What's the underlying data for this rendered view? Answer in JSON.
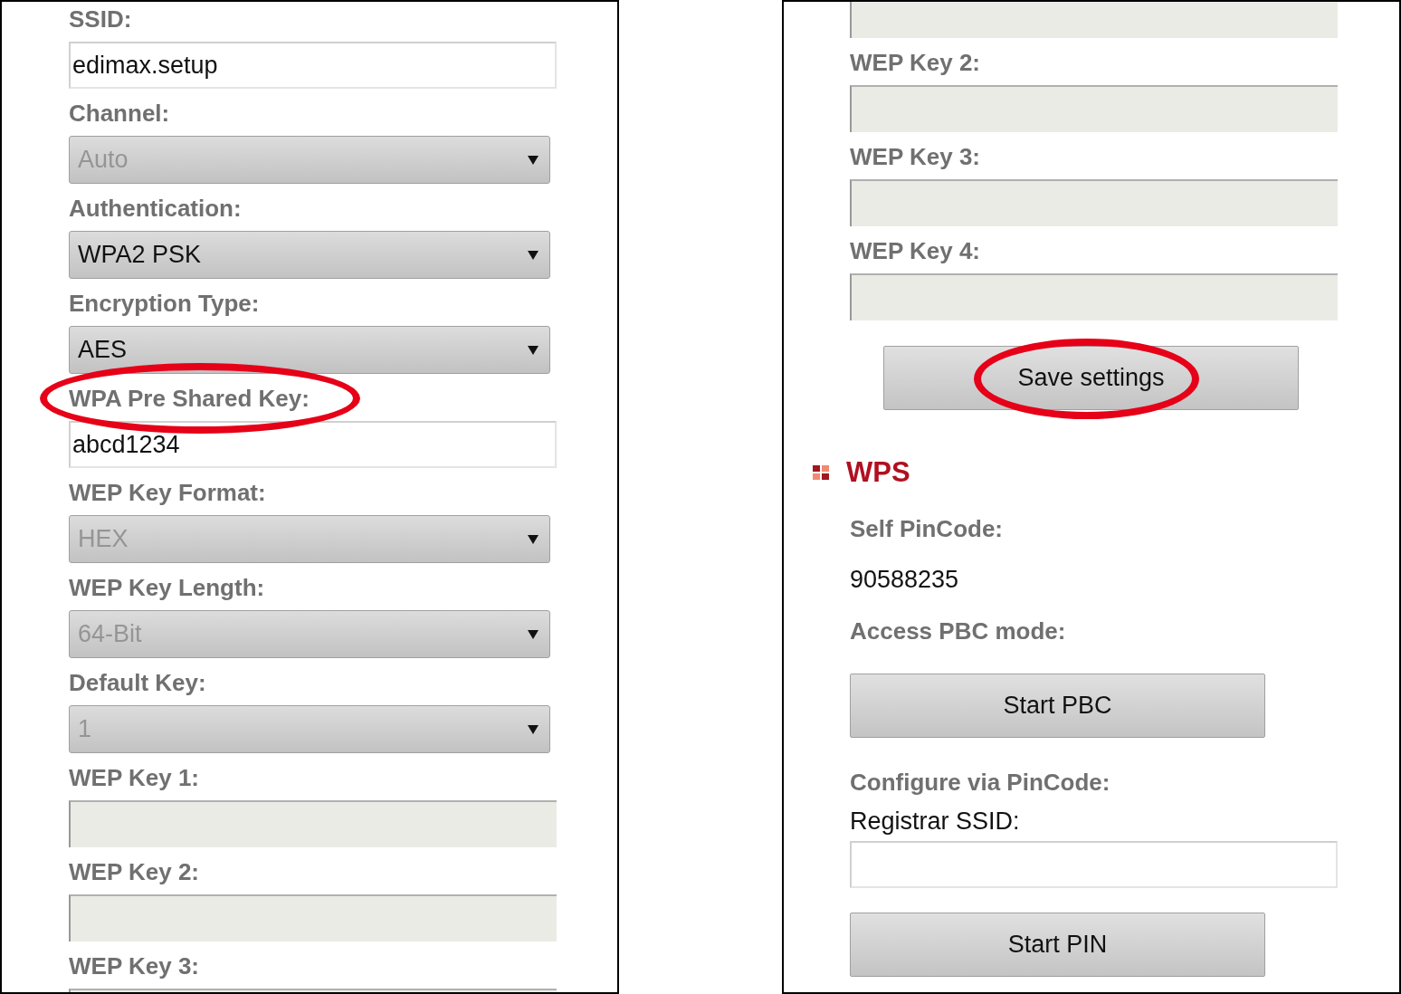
{
  "left_panel": {
    "fields": [
      {
        "label": "SSID:",
        "kind": "text",
        "value": "edimax.setup",
        "disabled": false,
        "circled": false
      },
      {
        "label": "Channel:",
        "kind": "select",
        "value": "Auto",
        "disabled": true,
        "circled": false
      },
      {
        "label": "Authentication:",
        "kind": "select",
        "value": "WPA2 PSK",
        "disabled": false,
        "circled": false
      },
      {
        "label": "Encryption Type:",
        "kind": "select",
        "value": "AES",
        "disabled": false,
        "circled": false
      },
      {
        "label": "WPA Pre Shared Key:",
        "kind": "text",
        "value": "abcd1234",
        "disabled": false,
        "circled": true
      },
      {
        "label": "WEP Key Format:",
        "kind": "select",
        "value": "HEX",
        "disabled": true,
        "circled": false
      },
      {
        "label": "WEP Key Length:",
        "kind": "select",
        "value": "64-Bit",
        "disabled": true,
        "circled": false
      },
      {
        "label": "Default Key:",
        "kind": "select",
        "value": "1",
        "disabled": true,
        "circled": false
      },
      {
        "label": "WEP Key 1:",
        "kind": "text",
        "disabled": true,
        "circled": false
      },
      {
        "label": "WEP Key 2:",
        "kind": "text",
        "disabled": true,
        "circled": false
      },
      {
        "label": "WEP Key 3:",
        "kind": "text",
        "disabled": true,
        "circled": false
      }
    ]
  },
  "right_panel": {
    "fields": [
      {
        "kind": "text",
        "disabled": true,
        "circled": false
      },
      {
        "label": "WEP Key 2:",
        "kind": "text",
        "disabled": true,
        "circled": false
      },
      {
        "label": "WEP Key 3:",
        "kind": "text",
        "disabled": true,
        "circled": false
      },
      {
        "label": "WEP Key 4:",
        "kind": "text",
        "disabled": true,
        "circled": false
      }
    ],
    "save_button": {
      "label": "Save settings",
      "circled": true
    },
    "wps": {
      "title": "WPS",
      "self_pincode_label": "Self PinCode:",
      "self_pincode": "90588235",
      "pbc_label": "Access PBC mode:",
      "pbc_button": "Start PBC",
      "pin_label": "Configure via PinCode:",
      "registrar_label": "Registrar SSID:",
      "pin_button": "Start PIN"
    }
  }
}
